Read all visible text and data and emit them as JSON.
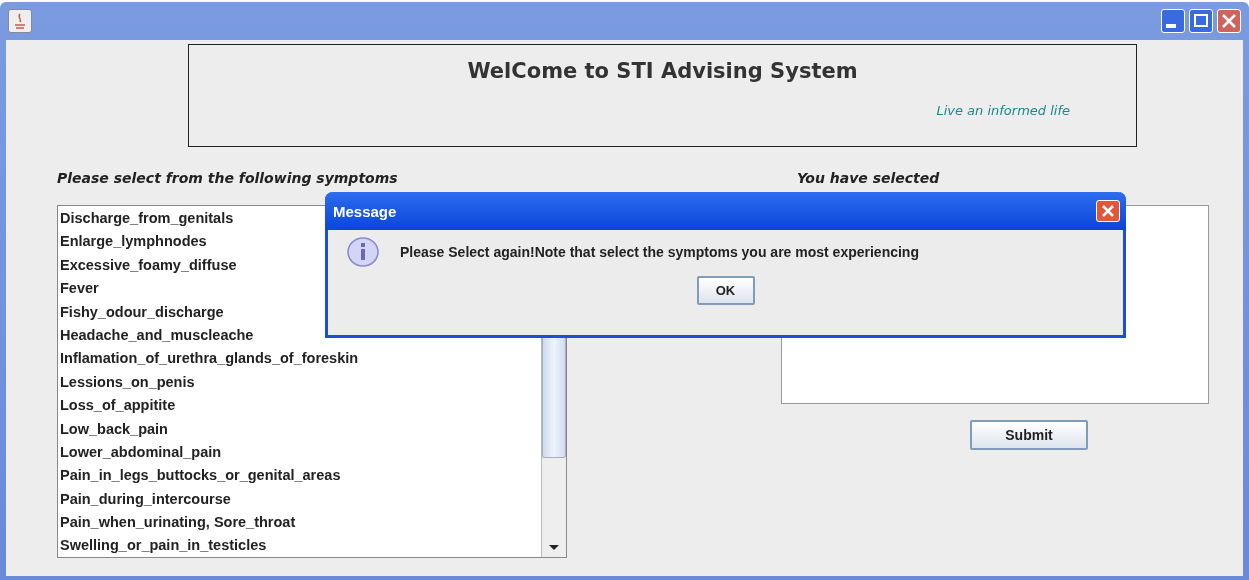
{
  "window": {
    "title_buttons": [
      {
        "kind": "minimize"
      },
      {
        "kind": "maximize"
      },
      {
        "kind": "close"
      }
    ]
  },
  "banner": {
    "title": "WelCome to STI Advising System",
    "tagline": "Live an informed life"
  },
  "symptoms": {
    "label": "Please select from the following symptoms",
    "items": [
      "Discharge_from_genitals",
      "Enlarge_lymphnodes",
      "Excessive_foamy_diffuse",
      "Fever",
      "Fishy_odour_discharge",
      "Headache_and_muscleache",
      "Inflamation_of_urethra_glands_of_foreskin",
      "Lessions_on_penis",
      "Loss_of_appitite",
      "Low_back_pain",
      "Lower_abdominal_pain",
      "Pain_in_legs_buttocks_or_genital_areas",
      "Pain_during_intercourse",
      "Pain_when_urinating, Sore_throat",
      "Swelling_or_pain_in_testicles"
    ]
  },
  "selected": {
    "label": "You have selected"
  },
  "submit_button": "Submit",
  "dialog": {
    "title": "Message",
    "message": "Please Select again!Note that select the symptoms you are most experiencing",
    "ok_button": "OK"
  }
}
